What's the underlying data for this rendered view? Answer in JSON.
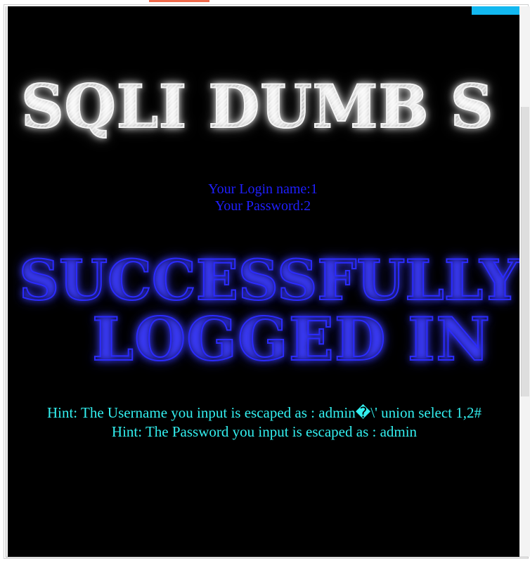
{
  "banner": {
    "title": "SQLI DUMB S"
  },
  "login": {
    "name_line": "Your Login name:1",
    "password_line": "Your Password:2"
  },
  "status": {
    "line1": "SUCCESSFULLY",
    "line2": "LOGGED IN"
  },
  "hints": {
    "username": "Hint: The Username you input is escaped as : admin�\\' union select 1,2#",
    "password": "Hint: The Password you input is escaped as : admin"
  },
  "colors": {
    "background": "#000000",
    "login_text": "#1f1fff",
    "hint_text": "#33f0f0",
    "accent_red": "#ef6a4b",
    "accent_cyan": "#12b8f0"
  }
}
